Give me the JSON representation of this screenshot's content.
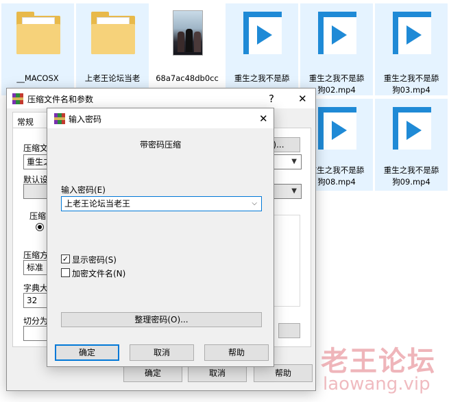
{
  "explorer": {
    "items": [
      {
        "label": "__MACOSX",
        "icon": "folder-icon"
      },
      {
        "label": "上老王论坛当老",
        "icon": "folder-icon"
      },
      {
        "label": "68a7ac48db0cc",
        "icon": "image-thumbnail-icon"
      },
      {
        "label": "重生之我不是舔",
        "icon": "video-file-icon"
      },
      {
        "label": "重生之我不是舔",
        "label2": "狗02.mp4",
        "icon": "video-file-icon"
      },
      {
        "label": "重生之我不是舔",
        "label2": "狗03.mp4",
        "icon": "video-file-icon"
      },
      {
        "label": "重生之我不是舔",
        "label2": "狗08.mp4",
        "icon": "video-file-icon"
      },
      {
        "label": "重生之我不是舔",
        "label2": "狗09.mp4",
        "icon": "video-file-icon"
      }
    ]
  },
  "parent_dialog": {
    "title": "压缩文件名和参数",
    "help_glyph": "?",
    "close_glyph": "✕",
    "tab_general": "常规",
    "archive_name_label": "压缩文",
    "archive_name_value": "重生之",
    "browse_button": "(B)...",
    "default_label": "默认设",
    "format_group_label": "压缩",
    "method_label": "压缩方",
    "method_value": "标准",
    "dict_label": "字典大",
    "dict_value": "32",
    "split_label": "切分为",
    "ok_button": "确定",
    "cancel_button": "取消",
    "help_button": "帮助"
  },
  "password_dialog": {
    "title": "输入密码",
    "close_glyph": "✕",
    "heading": "带密码压缩",
    "enter_password_label": "输入密码(E)",
    "password_value": "上老王论坛当老王",
    "show_password_label": "显示密码(S)",
    "show_password_checked": true,
    "encrypt_names_label": "加密文件名(N)",
    "encrypt_names_checked": false,
    "organize_button": "整理密码(O)...",
    "ok_button": "确定",
    "cancel_button": "取消",
    "help_button": "帮助"
  },
  "watermark": {
    "title": "老王论坛",
    "url": "laowang.vip"
  }
}
